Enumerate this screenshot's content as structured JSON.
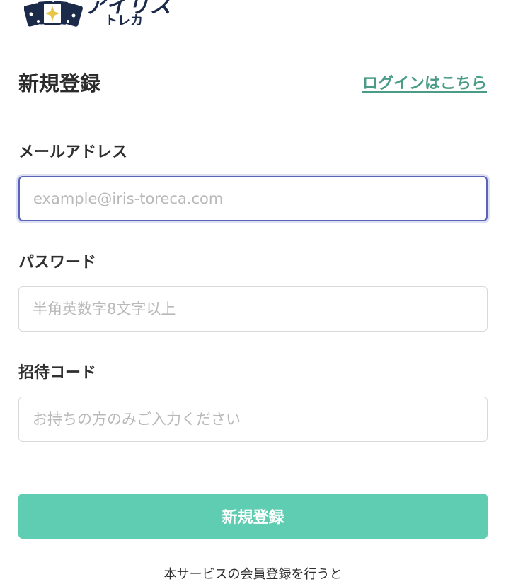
{
  "logo": {
    "title": "アイリス",
    "subtitle": "トレカ"
  },
  "header": {
    "title": "新規登録",
    "login_link": "ログインはこちら"
  },
  "form": {
    "email": {
      "label": "メールアドレス",
      "value": "",
      "placeholder": "example@iris-toreca.com"
    },
    "password": {
      "label": "パスワード",
      "value": "",
      "placeholder": "半角英数字8文字以上"
    },
    "invite_code": {
      "label": "招待コード",
      "value": "",
      "placeholder": "お持ちの方のみご入力ください"
    },
    "submit_label": "新規登録"
  },
  "footer": {
    "terms_text": "本サービスの会員登録を行うと"
  },
  "colors": {
    "accent": "#5fcdb1",
    "link": "#4a9c86",
    "focus_border": "#5a64b8"
  }
}
